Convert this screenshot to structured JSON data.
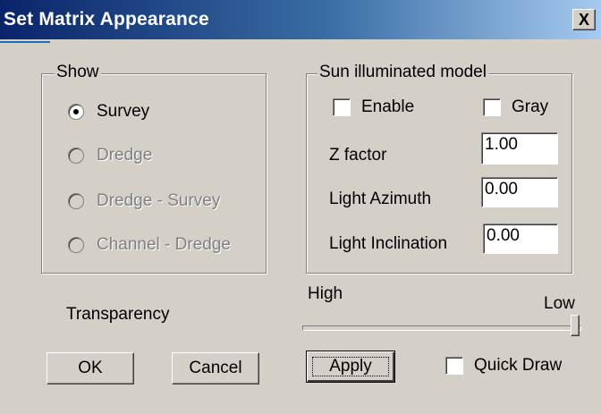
{
  "window": {
    "title": "Set Matrix Appearance",
    "close_glyph": "X"
  },
  "show_group": {
    "legend": "Show",
    "options": [
      {
        "label": "Survey",
        "selected": true,
        "enabled": true
      },
      {
        "label": "Dredge",
        "selected": false,
        "enabled": false
      },
      {
        "label": "Dredge - Survey",
        "selected": false,
        "enabled": false
      },
      {
        "label": "Channel - Dredge",
        "selected": false,
        "enabled": false
      }
    ]
  },
  "sun_group": {
    "legend": "Sun illuminated model",
    "enable_label": "Enable",
    "enable_checked": false,
    "gray_label": "Gray",
    "gray_checked": false,
    "z_factor_label": "Z factor",
    "z_factor_value": "1.00",
    "azimuth_label": "Light Azimuth",
    "azimuth_value": "0.00",
    "inclination_label": "Light Inclination",
    "inclination_value": "0.00"
  },
  "transparency": {
    "label": "Transparency",
    "high_label": "High",
    "low_label": "Low",
    "value_fraction": 1.0
  },
  "buttons": {
    "ok": "OK",
    "cancel": "Cancel",
    "apply": "Apply"
  },
  "quick_draw": {
    "label": "Quick Draw",
    "checked": false
  },
  "colors": {
    "title_start": "#0a246a",
    "title_end": "#a6caf0",
    "face": "#d4d0c8"
  }
}
